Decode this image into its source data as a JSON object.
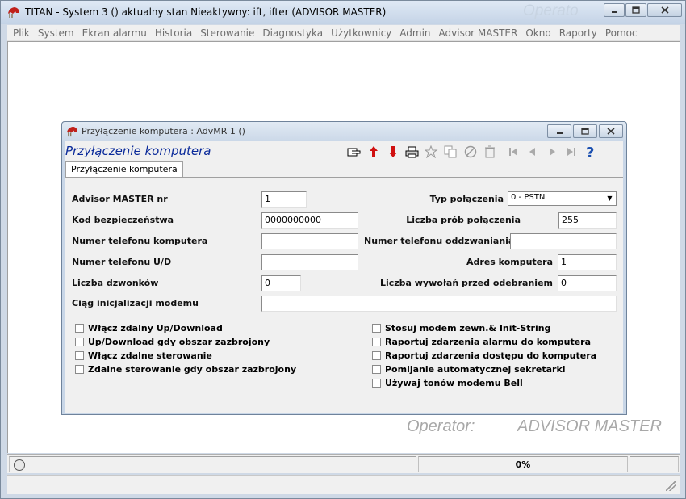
{
  "app": {
    "title": "TITAN - System 3 () aktualny stan Nieaktywny: ift, ifter (ADVISOR MASTER)",
    "ghost_text": "Operato"
  },
  "menu": [
    "Plik",
    "System",
    "Ekran alarmu",
    "Historia",
    "Sterowanie",
    "Diagnostyka",
    "Użytkownicy",
    "Admin",
    "Advisor MASTER",
    "Okno",
    "Raporty",
    "Pomoc"
  ],
  "dialog": {
    "window_title": "Przyłączenie komputera : AdvMR 1 ()",
    "heading": "Przyłączenie komputera",
    "tab_label": "Przyłączenie komputera",
    "fields": {
      "advisor_master_nr": {
        "label": "Advisor MASTER nr",
        "value": "1"
      },
      "kod_bezpieczenstwa": {
        "label": "Kod bezpieczeństwa",
        "value": "0000000000"
      },
      "numer_telefonu_komputera": {
        "label": "Numer telefonu komputera",
        "value": ""
      },
      "numer_telefonu_ud": {
        "label": "Numer telefonu U/D",
        "value": ""
      },
      "liczba_dzwonkow": {
        "label": "Liczba dzwonków",
        "value": "0"
      },
      "ciag_inicjalizacji": {
        "label": "Ciąg inicjalizacji modemu",
        "value": ""
      },
      "typ_polaczenia": {
        "label": "Typ połączenia",
        "value": "0 - PSTN"
      },
      "liczba_prob": {
        "label": "Liczba prób połączenia",
        "value": "255"
      },
      "numer_oddzwaniania": {
        "label": "Numer telefonu oddzwaniania",
        "value": ""
      },
      "adres_komputera": {
        "label": "Adres komputera",
        "value": "1"
      },
      "liczba_wywolan": {
        "label": "Liczba wywołań przed odebraniem",
        "value": "0"
      }
    },
    "checkboxes_left": [
      {
        "label": "Włącz zdalny Up/Download",
        "checked": false
      },
      {
        "label": "Up/Download gdy obszar zazbrojony",
        "checked": false
      },
      {
        "label": "Włącz zdalne sterowanie",
        "checked": false
      },
      {
        "label": "Zdalne sterowanie gdy obszar zazbrojony",
        "checked": false
      }
    ],
    "checkboxes_right": [
      {
        "label": "Stosuj modem zewn.& Init-String",
        "checked": false
      },
      {
        "label": "Raportuj zdarzenia alarmu do komputera",
        "checked": false
      },
      {
        "label": "Raportuj zdarzenia dostępu do komputera",
        "checked": false
      },
      {
        "label": "Pomijanie automatycznej sekretarki",
        "checked": false
      },
      {
        "label": "Używaj tonów modemu Bell",
        "checked": false
      }
    ]
  },
  "operator": {
    "label": "Operator:",
    "value": "ADVISOR MASTER"
  },
  "status": {
    "progress_text": "0%"
  },
  "colors": {
    "heading": "#0a2a9a",
    "toolbar_red": "#d01010",
    "help_blue": "#1a4fb0"
  }
}
